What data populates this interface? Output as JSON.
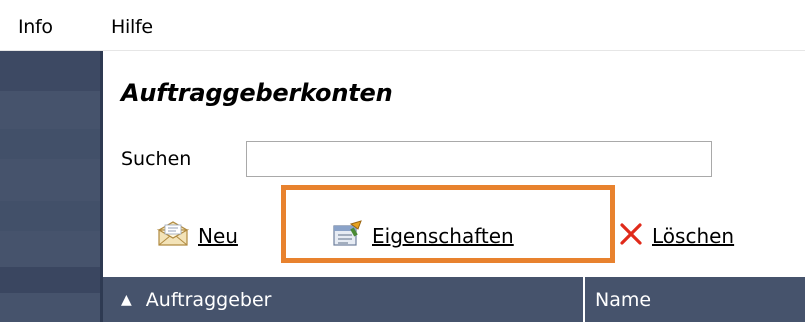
{
  "menu": {
    "items": [
      "Info",
      "Hilfe"
    ]
  },
  "page": {
    "title": "Auftraggeberkonten"
  },
  "search": {
    "label": "Suchen",
    "value": ""
  },
  "toolbar": {
    "new_label": "Neu",
    "properties_label": "Eigenschaften",
    "delete_label": "Löschen",
    "new_icon": "envelope-icon",
    "properties_icon": "properties-icon",
    "delete_icon": "red-x-icon",
    "highlight_color": "#e8822e"
  },
  "table": {
    "columns": [
      "Auftraggeber",
      "Name"
    ],
    "sort_column": "Auftraggeber",
    "sort_direction": "ascending",
    "header_color": "#46536c"
  },
  "colors": {
    "sidebar": "#46536c"
  }
}
